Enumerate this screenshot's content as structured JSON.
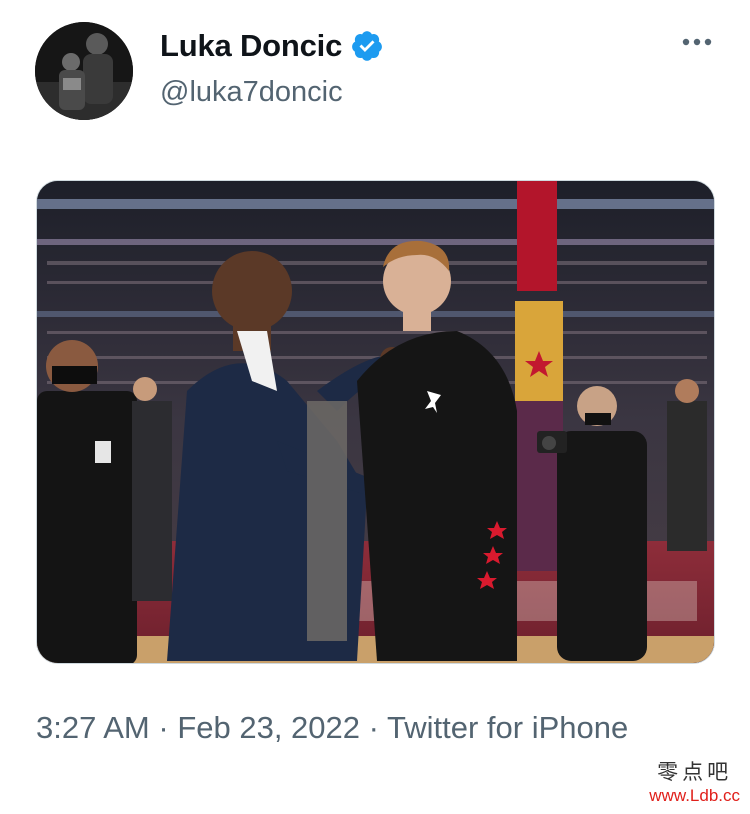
{
  "tweet": {
    "author": {
      "display_name": "Luka Doncic",
      "handle": "@luka7doncic",
      "verified": true,
      "avatar_icon": "avatar-photo"
    },
    "more_icon": "more-horizontal-icon",
    "timestamp": {
      "time": "3:27 AM",
      "separator": " · ",
      "date": "Feb 23, 2022",
      "source": "Twitter for iPhone"
    },
    "media": {
      "type": "photo",
      "jersey_logo": "Jordan jumpman"
    }
  },
  "watermark": {
    "cn": "零点吧",
    "url": "www.Ldb.cc",
    "url_color": "#e0201b"
  },
  "colors": {
    "text_primary": "#0f1419",
    "text_secondary": "#536471",
    "verified_blue": "#1d9bf0",
    "border": "#cfd9de"
  }
}
